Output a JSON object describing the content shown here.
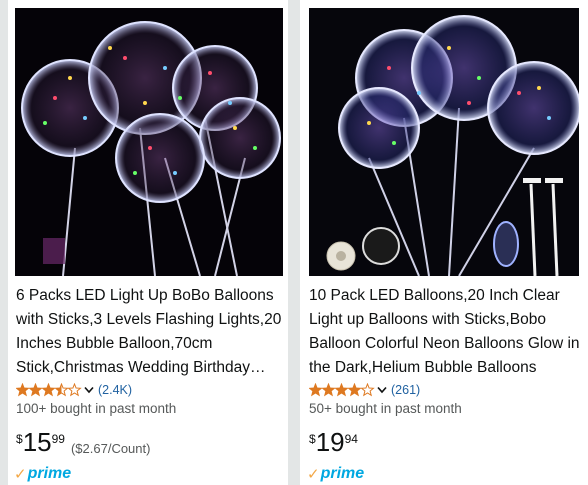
{
  "products": [
    {
      "title": "6 Packs LED Light Up BoBo Balloons with Sticks,3 Levels Flashing Lights,20 Inches Bubble Balloon,70cm Stick,Christmas Wedding Birthday Party Decoration",
      "rating_stars": 3.5,
      "reviews": "(2.4K)",
      "bought": "100+ bought in past month",
      "price_symbol": "$",
      "price_whole": "15",
      "price_fraction": "99",
      "unit_price": "($2.67/Count)",
      "badge": "prime",
      "image_icon": "led-balloons-photo"
    },
    {
      "title": "10 Pack LED Balloons,20 Inch Clear Light up Balloons with Sticks,Bobo Balloon Colorful Neon Balloons Glow in the Dark,Helium Bubble Balloons",
      "rating_stars": 4.0,
      "reviews": "(261)",
      "bought": "50+ bought in past month",
      "price_symbol": "$",
      "price_whole": "19",
      "price_fraction": "94",
      "unit_price": "",
      "badge": "prime",
      "image_icon": "led-balloons-kit-photo"
    }
  ],
  "colors": {
    "star": "#de7921",
    "link": "#2162a1",
    "prime_blue": "#00a8e1",
    "prime_check": "#f3a847",
    "muted": "#565959"
  }
}
